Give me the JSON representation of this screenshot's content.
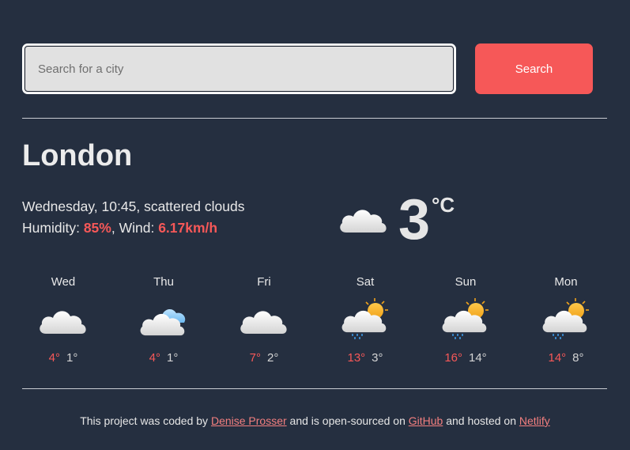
{
  "search": {
    "placeholder": "Search for a city",
    "button_label": "Search"
  },
  "current": {
    "city": "London",
    "datetime": "Wednesday, 10:45",
    "description": "scattered clouds",
    "humidity_label": "Humidity:",
    "humidity_value": "85%",
    "wind_label": "Wind:",
    "wind_value": "6.17km/h",
    "temperature": "3",
    "unit": "°C",
    "icon": "cloud-icon"
  },
  "forecast": [
    {
      "day": "Wed",
      "icon": "cloud-icon",
      "max": "4°",
      "min": "1°"
    },
    {
      "day": "Thu",
      "icon": "cloud-icon",
      "max": "4°",
      "min": "1°"
    },
    {
      "day": "Fri",
      "icon": "cloud-icon",
      "max": "7°",
      "min": "2°"
    },
    {
      "day": "Sat",
      "icon": "sun-rain-icon",
      "max": "13°",
      "min": "3°"
    },
    {
      "day": "Sun",
      "icon": "sun-rain-icon",
      "max": "16°",
      "min": "14°"
    },
    {
      "day": "Mon",
      "icon": "sun-rain-icon",
      "max": "14°",
      "min": "8°"
    }
  ],
  "footer": {
    "text1": "This project was coded by",
    "author": "Denise Prosser",
    "text2": "and is open-sourced on",
    "github": "GitHub",
    "text3": "and hosted on",
    "netlify": "Netlify"
  },
  "colors": {
    "background": "#252f40",
    "accent": "#f65858",
    "input_bg": "#e1e1e1"
  }
}
